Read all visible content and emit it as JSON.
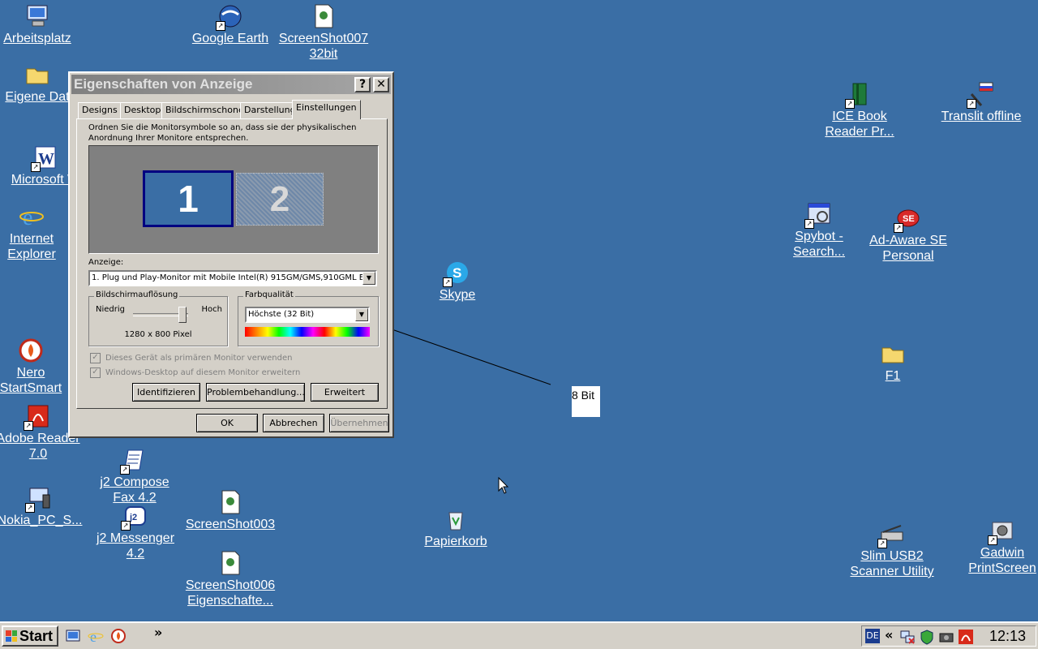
{
  "desktop": {
    "icons": {
      "arbeitsplatz": "Arbeitsplatz",
      "google_earth": "Google Earth",
      "screenshot007": "ScreenShot007\n32bit",
      "eigene_dateien": "Eigene Dat",
      "ice_book": "ICE Book\nReader Pr...",
      "translit": "Translit offline",
      "microsoft_word": "Microsoft W",
      "internet_explorer": "Internet\nExplorer",
      "spybot": "Spybot -\nSearch...",
      "adaware": "Ad-Aware SE\nPersonal",
      "skype": "Skype",
      "nero": "Nero\nStartSmart",
      "f1": "F1",
      "adobe_reader": "Adobe Reader\n7.0",
      "j2_compose": "j2 Compose\nFax 4.2",
      "nokia": "Nokia_PC_S...",
      "j2_messenger": "j2 Messenger\n4.2",
      "screenshot003": "ScreenShot003",
      "papierkorb": "Papierkorb",
      "screenshot006": "ScreenShot006\nEigenschafte...",
      "slim_usb2": "Slim USB2\nScanner Utility",
      "gadwin": "Gadwin\nPrintScreen"
    },
    "annotation_label": "8 Bit"
  },
  "dialog": {
    "title": "Eigenschaften von Anzeige",
    "help_btn": "?",
    "close_btn": "✕",
    "tabs": [
      "Designs",
      "Desktop",
      "Bildschirmschoner",
      "Darstellung",
      "Einstellungen"
    ],
    "instruction": "Ordnen Sie die Monitorsymbole so an, dass sie der physikalischen Anordnung Ihrer Monitore entsprechen.",
    "monitor1": "1",
    "monitor2": "2",
    "anzeige_label": "Anzeige:",
    "anzeige_value": "1. Plug und Play-Monitor mit Mobile Intel(R) 915GM/GMS,910GML Ex",
    "resolution_caption": "Bildschirmauflösung",
    "resolution_low": "Niedrig",
    "resolution_high": "Hoch",
    "resolution_value": "1280 x 800 Pixel",
    "resolution_slider_level": 1.0,
    "color_caption": "Farbqualität",
    "color_value": "Höchste (32 Bit)",
    "checkbox_primary": "Dieses Gerät als primären Monitor verwenden",
    "checkbox_extend": "Windows-Desktop auf diesem Monitor erweitern",
    "btn_identify": "Identifizieren",
    "btn_troubleshoot": "Problembehandlung...",
    "btn_advanced": "Erweitert",
    "btn_ok": "OK",
    "btn_cancel": "Abbrechen",
    "btn_apply": "Übernehmen"
  },
  "taskbar": {
    "start_label": "Start",
    "chevron": "»",
    "lang": "DE",
    "tray_chevron": "«",
    "clock": "12:13"
  }
}
